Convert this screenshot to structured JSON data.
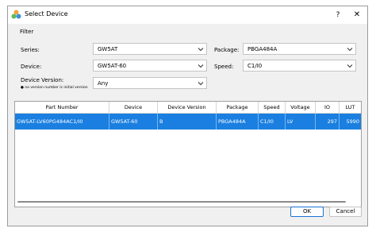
{
  "window": {
    "title": "Select Device",
    "help_label": "?",
    "close_label": "✕"
  },
  "filter": {
    "group_label": "Filter",
    "series_label": "Series:",
    "series_value": "GW5AT",
    "device_label": "Device:",
    "device_value": "GW5AT-60",
    "version_label": "Device Version:",
    "version_note": "no version number is initial version",
    "version_value": "Any",
    "package_label": "Package:",
    "package_value": "PBGA484A",
    "speed_label": "Speed:",
    "speed_value": "C1/I0"
  },
  "table": {
    "columns": [
      "Part Number",
      "Device",
      "Device Version",
      "Package",
      "Speed",
      "Voltage",
      "IO",
      "LUT"
    ],
    "rows": [
      [
        "GW5AT-LV60PG484AC1/I0",
        "GW5AT-60",
        "B",
        "PBGA484A",
        "C1/I0",
        "LV",
        "297",
        "5990"
      ]
    ]
  },
  "buttons": {
    "ok": "OK",
    "cancel": "Cancel"
  },
  "colors": {
    "selection": "#1a7fe0",
    "accent": "#1a73d6"
  }
}
